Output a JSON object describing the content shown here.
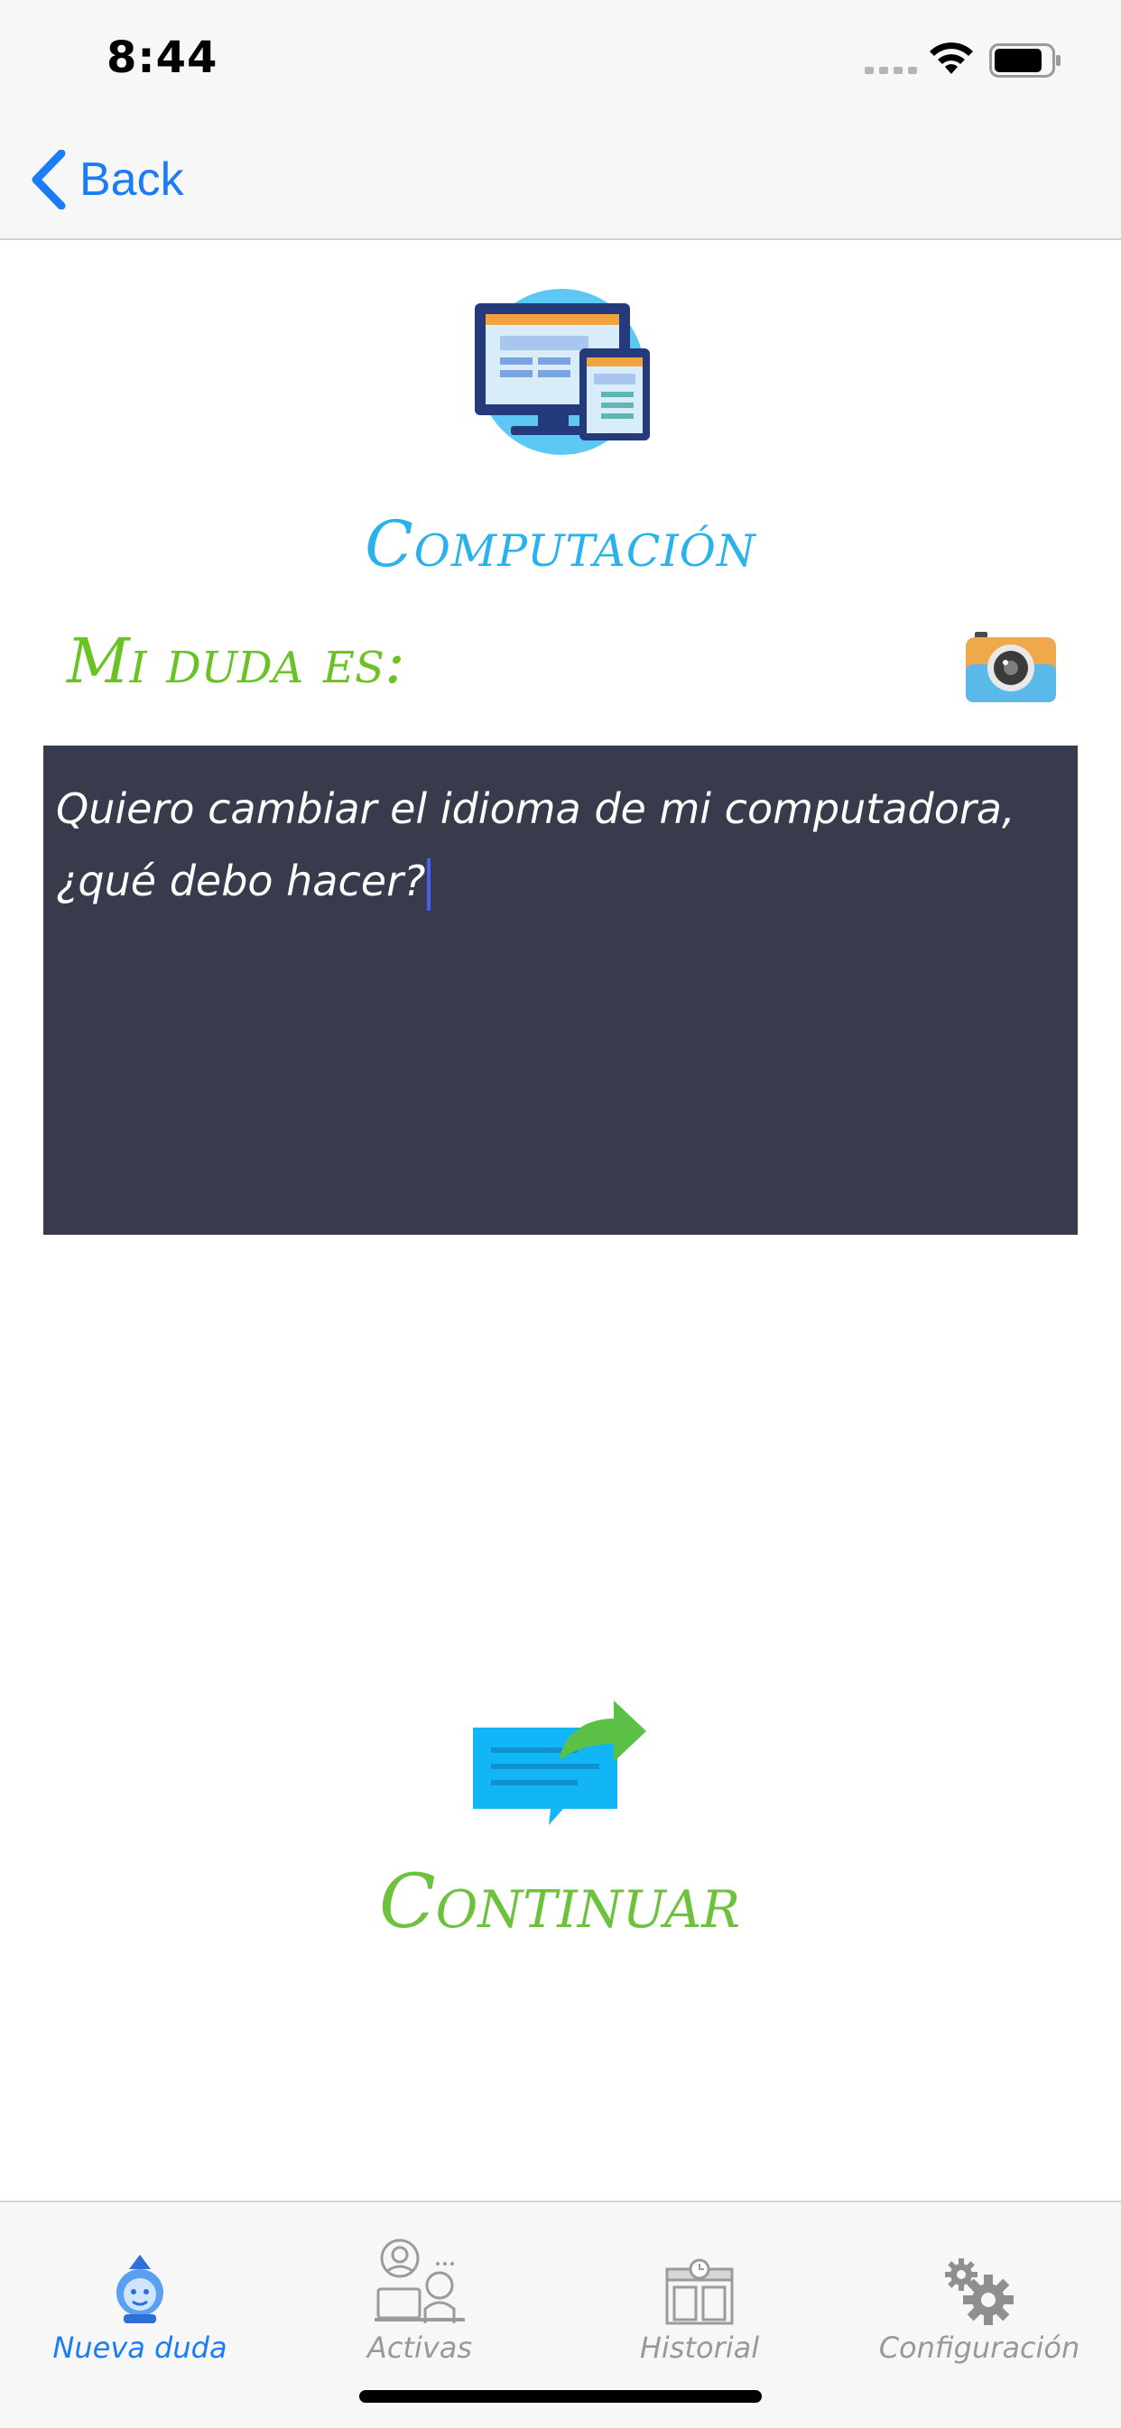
{
  "status": {
    "time": "8:44"
  },
  "nav": {
    "back_label": "Back"
  },
  "category": {
    "title": "Computación",
    "icon": "computer-devices-icon"
  },
  "question": {
    "label": "Mi duda es:",
    "text": "Quiero cambiar el idioma de mi computadora, ¿qué debo hacer?",
    "camera_icon": "camera-icon"
  },
  "continue": {
    "label": "Continuar",
    "icon": "message-forward-icon"
  },
  "tabs": [
    {
      "label": "Nueva duda",
      "icon": "new-question-icon",
      "active": true
    },
    {
      "label": "Activas",
      "icon": "active-users-icon",
      "active": false
    },
    {
      "label": "Historial",
      "icon": "history-icon",
      "active": false
    },
    {
      "label": "Configuración",
      "icon": "settings-icon",
      "active": false
    }
  ],
  "colors": {
    "accent_blue": "#1b7cf5",
    "title_blue": "#29b2ec",
    "label_green": "#6ac225",
    "box_dark": "#383b4b"
  }
}
